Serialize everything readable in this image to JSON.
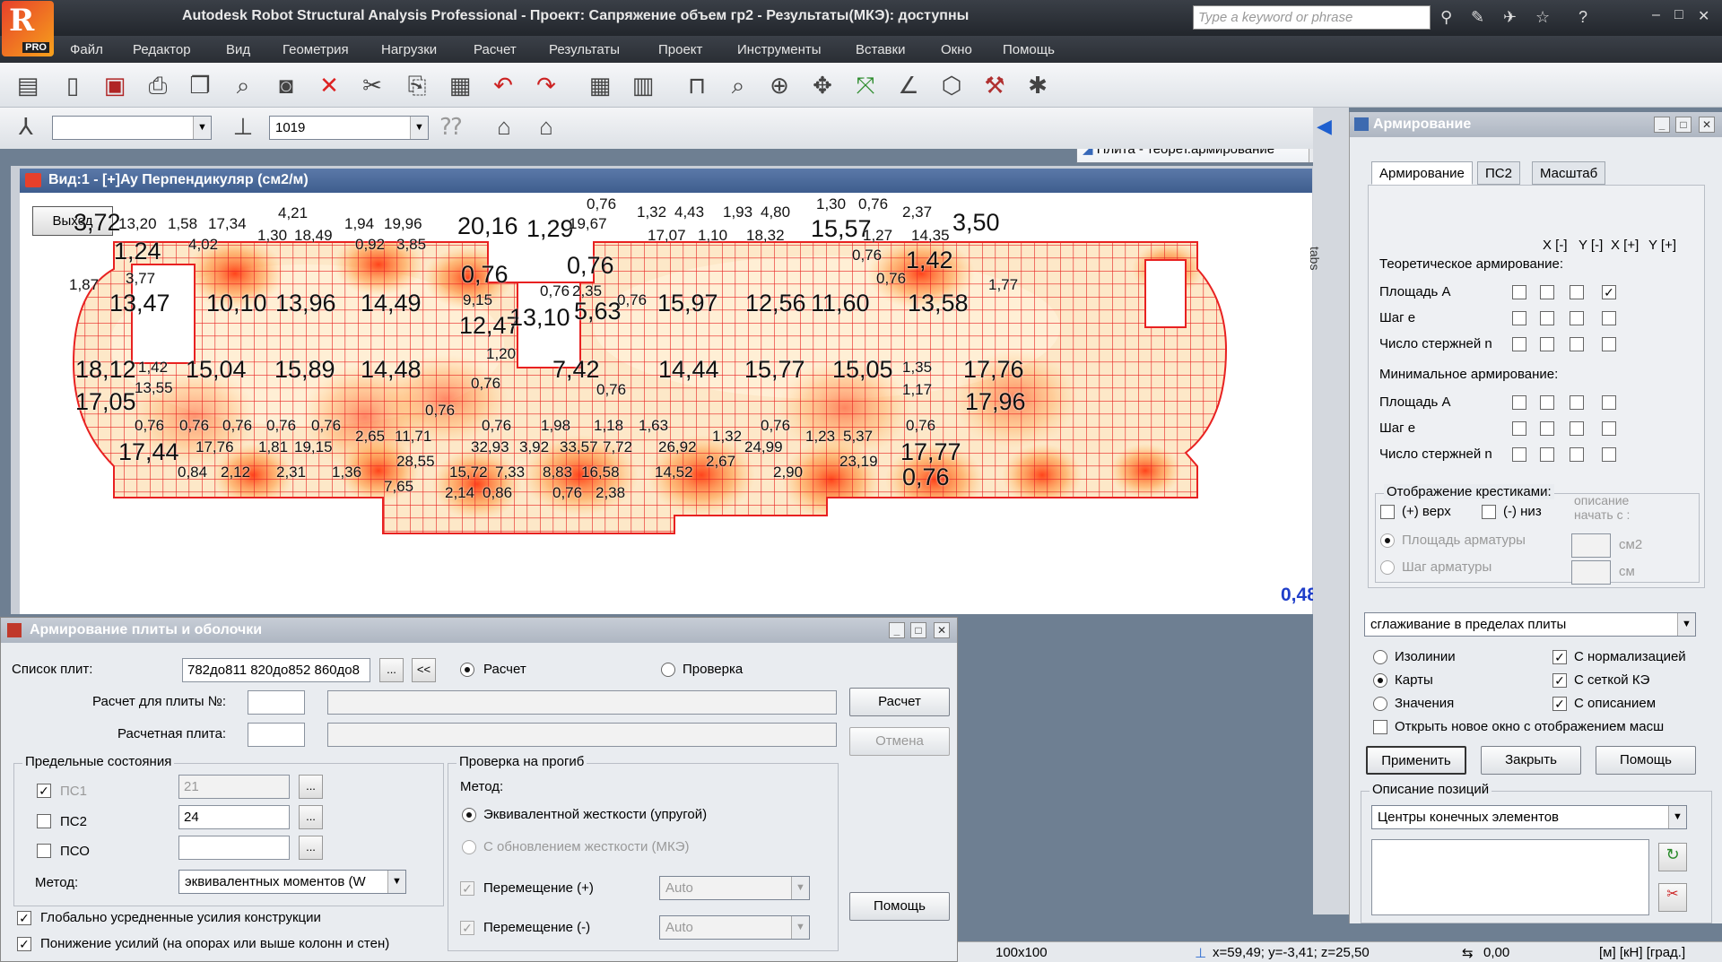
{
  "app": {
    "logo_letter": "R",
    "logo_pro": "PRO",
    "title": "Autodesk Robot Structural Analysis Professional - Проект: Сапряжение объем гр2 - Результаты(МКЭ): доступны",
    "search_placeholder": "Type a keyword or phrase"
  },
  "menu": [
    "Файл",
    "Редактор",
    "Вид",
    "Геометрия",
    "Нагрузки",
    "Расчет",
    "Результаты",
    "Проект",
    "Инструменты",
    "Вставки",
    "Окно",
    "Помощь"
  ],
  "toolbar": {
    "plate_combo": "Плита - теорет.армирование",
    "combo_empty": "",
    "case_combo": "1019"
  },
  "view": {
    "title": "Вид:1 - [+]Ay Перпендикуляр (см2/м)",
    "exit_label": "Выход",
    "scale_value": "0,48",
    "labels": [
      {
        "t": "3,72",
        "s": "b"
      },
      {
        "t": "13,20",
        "s": "s"
      },
      {
        "t": "1,58",
        "s": "s"
      },
      {
        "t": "17,34",
        "s": "s"
      },
      {
        "t": "4,21",
        "s": "s"
      },
      {
        "t": "1,94",
        "s": "s"
      },
      {
        "t": "19,96",
        "s": "s"
      },
      {
        "t": "20,16",
        "s": "b"
      },
      {
        "t": "1,29",
        "s": "b"
      },
      {
        "t": "19,67",
        "s": "s"
      },
      {
        "t": "0,76",
        "s": "s"
      },
      {
        "t": "1,32",
        "s": "s"
      },
      {
        "t": "4,43",
        "s": "s"
      },
      {
        "t": "1,93",
        "s": "s"
      },
      {
        "t": "4,80",
        "s": "s"
      },
      {
        "t": "1,30",
        "s": "s"
      },
      {
        "t": "0,76",
        "s": "s"
      },
      {
        "t": "2,37",
        "s": "s"
      },
      {
        "t": "3,50",
        "s": "b"
      },
      {
        "t": "1,30",
        "s": "s"
      },
      {
        "t": "18,49",
        "s": "s"
      },
      {
        "t": "0,92",
        "s": "s"
      },
      {
        "t": "3,85",
        "s": "s"
      },
      {
        "t": "17,07",
        "s": "s"
      },
      {
        "t": "1,10",
        "s": "s"
      },
      {
        "t": "18,32",
        "s": "s"
      },
      {
        "t": "15,57",
        "s": "b"
      },
      {
        "t": "1,27",
        "s": "s"
      },
      {
        "t": "14,35",
        "s": "s"
      },
      {
        "t": "1,24",
        "s": "b"
      },
      {
        "t": "4,02",
        "s": "s"
      },
      {
        "t": "0,76",
        "s": "b"
      },
      {
        "t": "0,76",
        "s": "b"
      },
      {
        "t": "0,76",
        "s": "s"
      },
      {
        "t": "1,42",
        "s": "b"
      },
      {
        "t": "3,77",
        "s": "s"
      },
      {
        "t": "1,87",
        "s": "s"
      },
      {
        "t": "0,76",
        "s": "s"
      },
      {
        "t": "1,77",
        "s": "s"
      },
      {
        "t": "0,76",
        "s": "s"
      },
      {
        "t": "2,35",
        "s": "s"
      },
      {
        "t": "13,47",
        "s": "b"
      },
      {
        "t": "10,10",
        "s": "b"
      },
      {
        "t": "13,96",
        "s": "b"
      },
      {
        "t": "14,49",
        "s": "b"
      },
      {
        "t": "9,15",
        "s": "s"
      },
      {
        "t": "0,76",
        "s": "s"
      },
      {
        "t": "15,97",
        "s": "b"
      },
      {
        "t": "12,56",
        "s": "b"
      },
      {
        "t": "11,60",
        "s": "b"
      },
      {
        "t": "13,58",
        "s": "b"
      },
      {
        "t": "12,47",
        "s": "b"
      },
      {
        "t": "13,10",
        "s": "b"
      },
      {
        "t": "5,63",
        "s": "b"
      },
      {
        "t": "1,20",
        "s": "s"
      },
      {
        "t": "18,12",
        "s": "b"
      },
      {
        "t": "1,42",
        "s": "s"
      },
      {
        "t": "15,04",
        "s": "b"
      },
      {
        "t": "15,89",
        "s": "b"
      },
      {
        "t": "14,48",
        "s": "b"
      },
      {
        "t": "7,42",
        "s": "b"
      },
      {
        "t": "14,44",
        "s": "b"
      },
      {
        "t": "15,77",
        "s": "b"
      },
      {
        "t": "15,05",
        "s": "b"
      },
      {
        "t": "1,35",
        "s": "s"
      },
      {
        "t": "17,76",
        "s": "b"
      },
      {
        "t": "0,76",
        "s": "s"
      },
      {
        "t": "13,55",
        "s": "s"
      },
      {
        "t": "0,76",
        "s": "s"
      },
      {
        "t": "1,17",
        "s": "s"
      },
      {
        "t": "17,05",
        "s": "b"
      },
      {
        "t": "17,96",
        "s": "b"
      },
      {
        "t": "0,76",
        "s": "s"
      },
      {
        "t": "0,76",
        "s": "s"
      },
      {
        "t": "0,76",
        "s": "s"
      },
      {
        "t": "0,76",
        "s": "s"
      },
      {
        "t": "0,76",
        "s": "s"
      },
      {
        "t": "0,76",
        "s": "s"
      },
      {
        "t": "0,76",
        "s": "s"
      },
      {
        "t": "1,98",
        "s": "s"
      },
      {
        "t": "1,18",
        "s": "s"
      },
      {
        "t": "1,63",
        "s": "s"
      },
      {
        "t": "0,76",
        "s": "s"
      },
      {
        "t": "0,76",
        "s": "s"
      },
      {
        "t": "2,65",
        "s": "s"
      },
      {
        "t": "11,71",
        "s": "s"
      },
      {
        "t": "1,32",
        "s": "s"
      },
      {
        "t": "1,23",
        "s": "s"
      },
      {
        "t": "5,37",
        "s": "s"
      },
      {
        "t": "17,44",
        "s": "b"
      },
      {
        "t": "17,76",
        "s": "s"
      },
      {
        "t": "1,81",
        "s": "s"
      },
      {
        "t": "19,15",
        "s": "s"
      },
      {
        "t": "32,93",
        "s": "s"
      },
      {
        "t": "3,92",
        "s": "s"
      },
      {
        "t": "33,57",
        "s": "s"
      },
      {
        "t": "7,72",
        "s": "s"
      },
      {
        "t": "26,92",
        "s": "s"
      },
      {
        "t": "24,99",
        "s": "s"
      },
      {
        "t": "17,77",
        "s": "b"
      },
      {
        "t": "28,55",
        "s": "s"
      },
      {
        "t": "2,67",
        "s": "s"
      },
      {
        "t": "23,19",
        "s": "s"
      },
      {
        "t": "0,84",
        "s": "s"
      },
      {
        "t": "2,12",
        "s": "s"
      },
      {
        "t": "2,31",
        "s": "s"
      },
      {
        "t": "1,36",
        "s": "s"
      },
      {
        "t": "15,72",
        "s": "s"
      },
      {
        "t": "7,33",
        "s": "s"
      },
      {
        "t": "8,83",
        "s": "s"
      },
      {
        "t": "16,58",
        "s": "s"
      },
      {
        "t": "14,52",
        "s": "s"
      },
      {
        "t": "2,90",
        "s": "s"
      },
      {
        "t": "0,76",
        "s": "b"
      },
      {
        "t": "7,65",
        "s": "s"
      },
      {
        "t": "2,14",
        "s": "s"
      },
      {
        "t": "0,86",
        "s": "s"
      },
      {
        "t": "0,76",
        "s": "s"
      },
      {
        "t": "2,38",
        "s": "s"
      }
    ]
  },
  "tabs_strip": "tabs",
  "right_panel": {
    "title": "Армирование",
    "tabs": [
      "Армирование",
      "ПС2",
      "Масштаб"
    ],
    "col_headers": [
      "X [-]",
      "Y [-]",
      "X [+]",
      "Y [+]"
    ],
    "theoretical": "Теоретическое армирование:",
    "minimal": "Минимальное армирование:",
    "rows": [
      "Площадь A",
      "Шаг e",
      "Число стержней n"
    ],
    "cross_group": "Отображение крестиками:",
    "cross_top": "(+) верх",
    "cross_bottom": "(-) низ",
    "desc_start": "описание начать с :",
    "area_reinf": "Площадь арматуры",
    "step_reinf": "Шаг арматуры",
    "unit_cm2": "см2",
    "unit_cm": "см",
    "smoothing": "сглаживание в пределах плиты",
    "isolines": "Изолинии",
    "maps": "Карты",
    "values": "Значения",
    "with_norm": "С нормализацией",
    "with_mesh": "С сеткой КЭ",
    "with_desc": "С описанием",
    "open_new": "Открыть новое окно с отображением масш",
    "apply": "Применить",
    "close": "Закрыть",
    "help": "Помощь",
    "pos_group": "Описание позиций",
    "pos_combo": "Центры конечных элементов"
  },
  "bottom_panel": {
    "title": "Армирование плиты и оболочки",
    "plate_list_label": "Список плит:",
    "plate_list_value": "782до811 820до852 860до8",
    "more": "...",
    "back": "<<",
    "calc_radio": "Расчет",
    "check_radio": "Проверка",
    "calc_for_label": "Расчет для плиты №:",
    "design_plate_label": "Расчетная плита:",
    "calc_btn": "Расчет",
    "cancel_btn": "Отмена",
    "limit_group": "Предельные состояния",
    "ps1": "ПС1",
    "ps1_value": "21",
    "ps2": "ПС2",
    "ps2_value": "24",
    "pso": "ПСО",
    "method_label": "Метод:",
    "method_value": "эквивалентных моментов (W",
    "global_avg": "Глобально усредненные усилия конструкции",
    "reduce": "Понижение усилий (на опорах или выше колонн и стен)",
    "defl_group": "Проверка на прогиб",
    "defl_method": "Метод:",
    "equiv_stiff": "Эквивалентной жесткости (упругой)",
    "update_stiff": "С обновлением жесткости (МКЭ)",
    "disp_plus": "Перемещение (+)",
    "disp_minus": "Перемещение (-)",
    "auto": "Auto",
    "help_btn": "Помощь"
  },
  "status": {
    "grid": "100x100",
    "coords": "x=59,49; y=-3,41; z=25,50",
    "angle": "0,00",
    "units": "[м] [кН] [град.]"
  },
  "colors": {
    "mesh": "#e82121",
    "accent": "#1f3ec9",
    "title": "#3e5d8e"
  }
}
